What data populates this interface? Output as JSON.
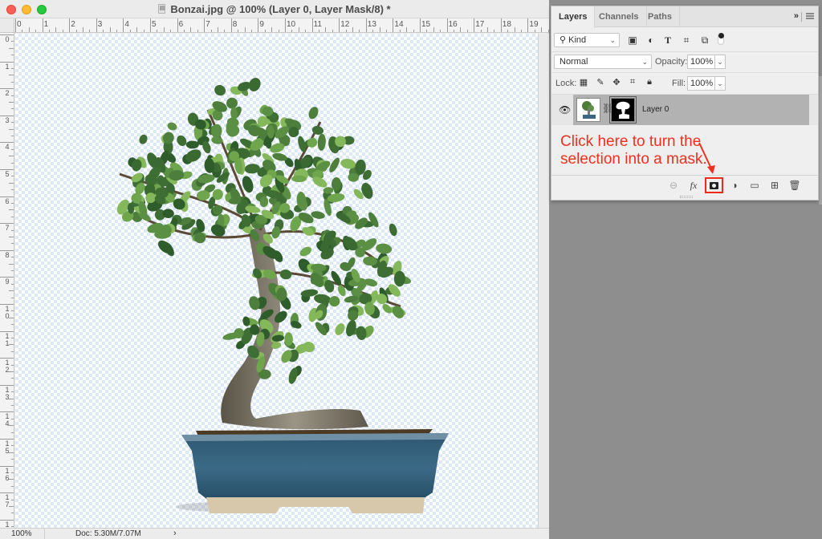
{
  "document_window": {
    "title": "Bonzai.jpg @ 100% (Layer 0, Layer Mask/8) *",
    "ruler_top_labels": [
      "0",
      "1",
      "2",
      "3",
      "4",
      "5",
      "6",
      "7",
      "8",
      "9",
      "10",
      "11",
      "12",
      "13",
      "14",
      "15",
      "16",
      "17",
      "18",
      "19"
    ],
    "ruler_left_labels": [
      "0",
      "1",
      "2",
      "3",
      "4",
      "5",
      "6",
      "7",
      "8",
      "9",
      "1 0",
      "1 1",
      "1 2",
      "1 3",
      "1 4",
      "1 5",
      "1 6",
      "1 7",
      "1"
    ],
    "status": {
      "zoom": "100%",
      "doc_size": "Doc: 5.30M/7.07M",
      "arrow": "›"
    },
    "image_subject": "Bonsai tree in blue glazed pot on transparent background"
  },
  "layers_panel": {
    "tabs": [
      {
        "label": "Layers",
        "active": true
      },
      {
        "label": "Channels",
        "active": false
      },
      {
        "label": "Paths",
        "active": false
      }
    ],
    "collapse_label": "»",
    "filter": {
      "kind_label": "Kind",
      "icons": [
        "image-filter-icon",
        "adjustment-filter-icon",
        "type-filter-icon",
        "shape-filter-icon",
        "smart-object-filter-icon",
        "filter-toggle-icon"
      ]
    },
    "blend_mode": "Normal",
    "opacity_label": "Opacity:",
    "opacity_value": "100%",
    "lock_label": "Lock:",
    "fill_label": "Fill:",
    "fill_value": "100%",
    "layers": [
      {
        "name": "Layer 0",
        "visible": true,
        "has_mask": true,
        "selected": true
      }
    ],
    "footer_icons": [
      "link-layers-icon",
      "fx-icon",
      "add-mask-icon",
      "adjustment-layer-icon",
      "group-folder-icon",
      "new-layer-icon",
      "trash-icon"
    ]
  },
  "annotation": {
    "line1": "Click here to turn the",
    "line2": "selection into a mask.",
    "color": "#f0301f"
  },
  "colors": {
    "annotation_red": "#f0301f",
    "highlight_box": "#ee2a1a",
    "checker_blue": "#dde9f7",
    "workspace_gray": "#8e8e8e"
  }
}
